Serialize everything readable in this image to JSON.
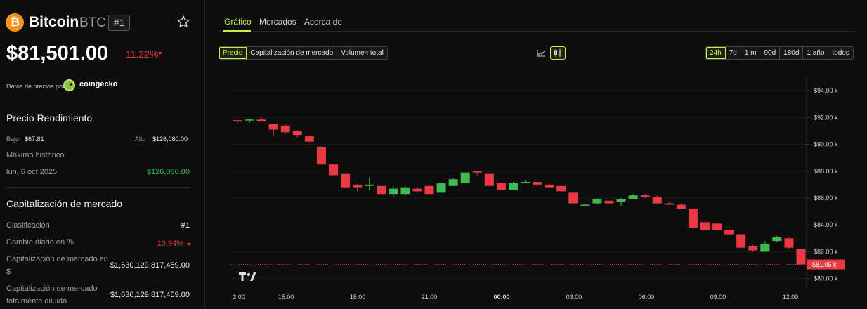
{
  "coin": {
    "logo_glyph": "₿",
    "name": "Bitcoin",
    "symbol": "BTC",
    "rank_badge": "#1",
    "price": "$81,501.00",
    "change_pct": "11.22%",
    "data_source_label": "Datos de precios por",
    "data_source_name": "coingecko"
  },
  "performance": {
    "title": "Precio Rendimiento",
    "low_label": "Bajo",
    "low_value": "$67.81",
    "high_label": "Alto",
    "high_value": "$126,080.00",
    "ath_label": "Máximo histórico",
    "ath_date": "lun, 6 oct 2025",
    "ath_value": "$126,080.00"
  },
  "market_cap": {
    "title": "Capitalización de mercado",
    "rows": [
      {
        "label": "Clasificación",
        "value": "#1"
      },
      {
        "label": "Cambio diario en %",
        "value": "10.94%"
      },
      {
        "label": "Capitalización de mercado en $",
        "value": "$1,630,129,817,459.00"
      },
      {
        "label": "Capitalización de mercado totalmente diluida",
        "value": "$1,630,129,817,459.00"
      }
    ]
  },
  "tabs": [
    "Gráfico",
    "Mercados",
    "Acerca de"
  ],
  "metric_buttons": [
    "Precio",
    "Capitalización de mercado",
    "Volumen total"
  ],
  "range_buttons": [
    "24h",
    "7d",
    "1 m",
    "90d",
    "180d",
    "1 año",
    "todos"
  ],
  "icons": {
    "star": "star-icon",
    "line_chart": "line-chart-icon",
    "candle_chart": "candlestick-chart-icon",
    "watermark": "tradingview-logo-icon"
  },
  "colors": {
    "up": "#3fb950",
    "down": "#ea3943",
    "accent": "#c8f04a",
    "bitcoin": "#f7931a"
  },
  "chart_data": {
    "type": "candlestick",
    "y_ticks": [
      "$94.00 k",
      "$92.00 k",
      "$90.00 k",
      "$88.00 k",
      "$86.00 k",
      "$84.00 k",
      "$82.00 k",
      "$80.00 k"
    ],
    "x_ticks": [
      "3:00",
      "15:00",
      "18:00",
      "21:00",
      "00:00",
      "03:00",
      "06:00",
      "09:00",
      "12:00"
    ],
    "ylim": [
      79.3,
      95.0
    ],
    "y_unit": "thousand USD",
    "current_price_label": "$81.05 k",
    "current_price": 81.05,
    "candles": [
      {
        "o": 91.8,
        "h": 91.9,
        "l": 91.6,
        "c": 91.7
      },
      {
        "o": 91.8,
        "h": 91.9,
        "l": 91.6,
        "c": 91.85
      },
      {
        "o": 91.85,
        "h": 92.0,
        "l": 91.75,
        "c": 91.7
      },
      {
        "o": 91.5,
        "h": 91.55,
        "l": 90.6,
        "c": 91.1
      },
      {
        "o": 91.4,
        "h": 91.5,
        "l": 90.8,
        "c": 90.9
      },
      {
        "o": 91.0,
        "h": 91.05,
        "l": 90.5,
        "c": 90.7
      },
      {
        "o": 90.6,
        "h": 90.65,
        "l": 90.2,
        "c": 90.2
      },
      {
        "o": 89.8,
        "h": 89.85,
        "l": 88.5,
        "c": 88.5
      },
      {
        "o": 88.5,
        "h": 88.5,
        "l": 87.7,
        "c": 87.7
      },
      {
        "o": 87.8,
        "h": 87.8,
        "l": 86.8,
        "c": 86.8
      },
      {
        "o": 87.0,
        "h": 87.1,
        "l": 86.5,
        "c": 86.8
      },
      {
        "o": 86.9,
        "h": 87.5,
        "l": 86.6,
        "c": 87.0
      },
      {
        "o": 86.9,
        "h": 86.9,
        "l": 86.3,
        "c": 86.3
      },
      {
        "o": 86.3,
        "h": 86.9,
        "l": 86.1,
        "c": 86.7
      },
      {
        "o": 86.3,
        "h": 86.9,
        "l": 86.2,
        "c": 86.8
      },
      {
        "o": 86.7,
        "h": 86.8,
        "l": 86.4,
        "c": 86.5
      },
      {
        "o": 86.9,
        "h": 86.9,
        "l": 86.3,
        "c": 86.3
      },
      {
        "o": 86.4,
        "h": 87.1,
        "l": 86.4,
        "c": 87.1
      },
      {
        "o": 86.9,
        "h": 87.5,
        "l": 86.9,
        "c": 87.4
      },
      {
        "o": 87.1,
        "h": 87.9,
        "l": 87.1,
        "c": 87.9
      },
      {
        "o": 88.0,
        "h": 88.0,
        "l": 87.7,
        "c": 87.9
      },
      {
        "o": 87.8,
        "h": 87.8,
        "l": 86.9,
        "c": 86.9
      },
      {
        "o": 87.1,
        "h": 87.1,
        "l": 86.6,
        "c": 86.6
      },
      {
        "o": 86.6,
        "h": 87.2,
        "l": 86.6,
        "c": 87.1
      },
      {
        "o": 87.1,
        "h": 87.3,
        "l": 87.1,
        "c": 87.2
      },
      {
        "o": 87.2,
        "h": 87.3,
        "l": 86.9,
        "c": 87.0
      },
      {
        "o": 87.0,
        "h": 87.2,
        "l": 86.7,
        "c": 86.8
      },
      {
        "o": 86.9,
        "h": 86.9,
        "l": 86.4,
        "c": 86.5
      },
      {
        "o": 86.4,
        "h": 86.4,
        "l": 85.5,
        "c": 85.6
      },
      {
        "o": 85.5,
        "h": 85.6,
        "l": 85.4,
        "c": 85.5
      },
      {
        "o": 85.6,
        "h": 86.0,
        "l": 85.5,
        "c": 85.9
      },
      {
        "o": 85.8,
        "h": 85.8,
        "l": 85.6,
        "c": 85.6
      },
      {
        "o": 85.7,
        "h": 86.0,
        "l": 85.4,
        "c": 85.9
      },
      {
        "o": 85.9,
        "h": 86.3,
        "l": 85.9,
        "c": 86.2
      },
      {
        "o": 86.2,
        "h": 86.3,
        "l": 86.0,
        "c": 86.1
      },
      {
        "o": 86.1,
        "h": 86.2,
        "l": 85.6,
        "c": 85.6
      },
      {
        "o": 85.6,
        "h": 85.7,
        "l": 85.5,
        "c": 85.5
      },
      {
        "o": 85.5,
        "h": 85.6,
        "l": 85.2,
        "c": 85.2
      },
      {
        "o": 85.2,
        "h": 85.2,
        "l": 83.6,
        "c": 83.8
      },
      {
        "o": 84.2,
        "h": 84.3,
        "l": 83.9,
        "c": 83.6
      },
      {
        "o": 84.1,
        "h": 84.2,
        "l": 83.6,
        "c": 83.6
      },
      {
        "o": 83.6,
        "h": 83.9,
        "l": 83.4,
        "c": 83.3
      },
      {
        "o": 83.3,
        "h": 83.3,
        "l": 82.3,
        "c": 82.3
      },
      {
        "o": 82.4,
        "h": 82.5,
        "l": 82.0,
        "c": 82.1
      },
      {
        "o": 82.0,
        "h": 82.8,
        "l": 82.0,
        "c": 82.6
      },
      {
        "o": 82.8,
        "h": 83.2,
        "l": 82.7,
        "c": 83.1
      },
      {
        "o": 83.0,
        "h": 83.1,
        "l": 82.2,
        "c": 82.3
      },
      {
        "o": 82.2,
        "h": 82.2,
        "l": 81.05,
        "c": 81.05
      }
    ]
  }
}
